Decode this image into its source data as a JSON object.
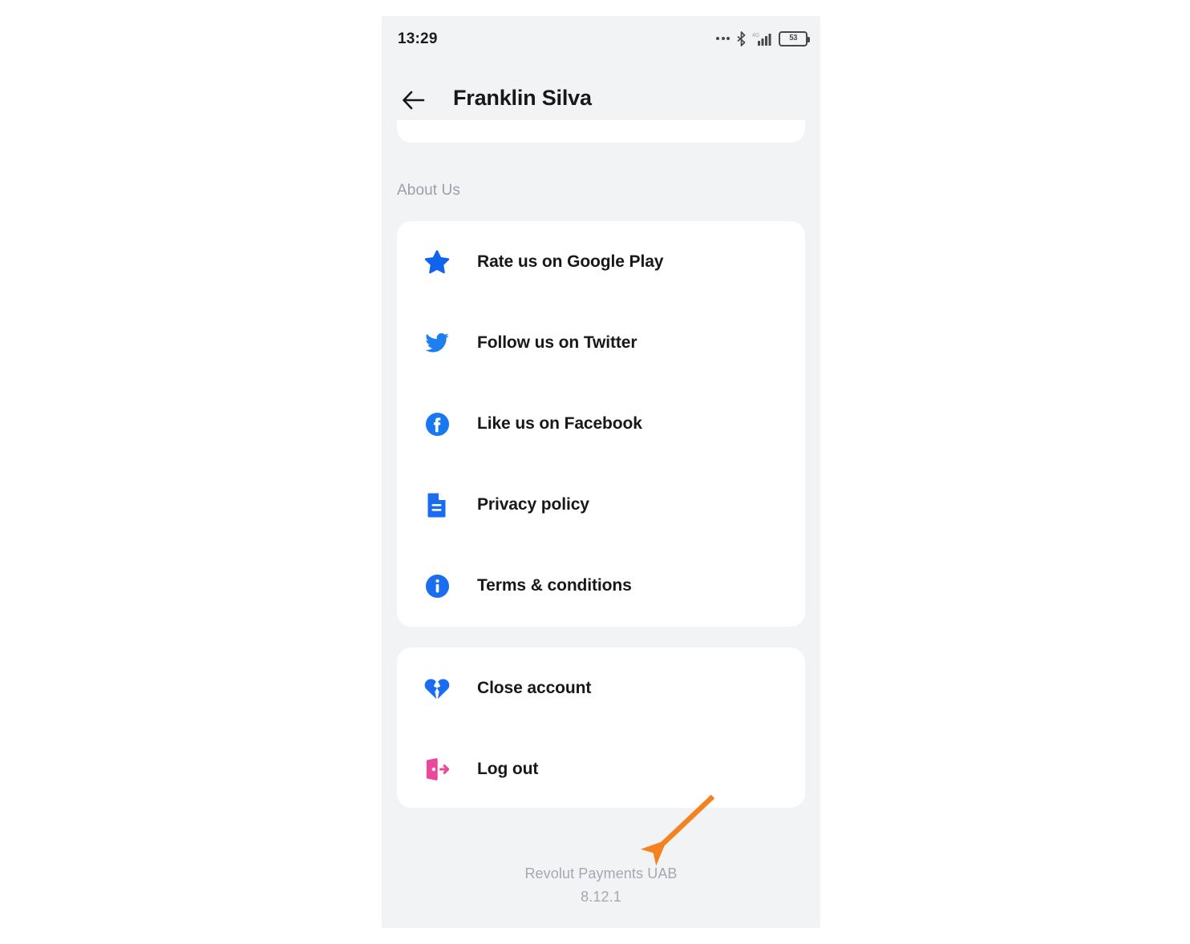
{
  "status_bar": {
    "time": "13:29",
    "icons": [
      "more-dots-icon",
      "bluetooth-icon",
      "signal-4g-icon",
      "battery-icon"
    ],
    "network_label": "4G",
    "battery_percent": "53"
  },
  "app_bar": {
    "back_icon": "back-arrow-icon",
    "title": "Franklin Silva"
  },
  "sections": [
    {
      "label": "About Us",
      "items": [
        {
          "icon": "star-icon",
          "label": "Rate us on Google Play",
          "color": "#1063ee"
        },
        {
          "icon": "twitter-icon",
          "label": "Follow us on Twitter",
          "color": "#1d7ff0"
        },
        {
          "icon": "facebook-icon",
          "label": "Like us on Facebook",
          "color": "#1877f2"
        },
        {
          "icon": "document-icon",
          "label": "Privacy policy",
          "color": "#1a6df0"
        },
        {
          "icon": "info-icon",
          "label": "Terms & conditions",
          "color": "#1a6df0"
        }
      ]
    },
    {
      "label": "",
      "items": [
        {
          "icon": "broken-heart-icon",
          "label": "Close account",
          "color": "#1a6df0"
        },
        {
          "icon": "logout-icon",
          "label": "Log out",
          "color": "#ec4899"
        }
      ]
    }
  ],
  "footer": {
    "company": "Revolut Payments UAB",
    "version": "8.12.1"
  },
  "annotation": {
    "type": "arrow",
    "color": "#f58220",
    "points_to": "footer.company"
  },
  "colors": {
    "page_background": "#ffffff",
    "screen_background": "#f2f3f5",
    "card_background": "#ffffff",
    "primary_text": "#17181a",
    "muted_text": "#9ba0a8",
    "accent_blue": "#1a6df0",
    "accent_pink": "#ec4899",
    "annotation_orange": "#f58220"
  }
}
